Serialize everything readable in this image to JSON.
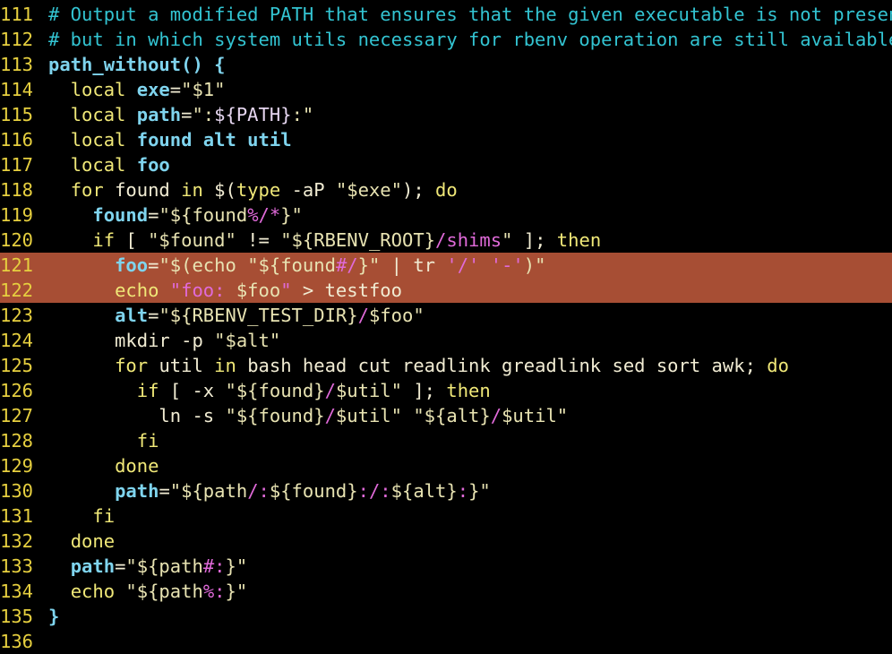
{
  "editor": {
    "colors": {
      "background": "#000000",
      "line_number": "#e6cf3f",
      "highlight": "#a74e34",
      "comment": "#33c4d2",
      "keyword": "#f0e878",
      "variable": "#7fd4ee",
      "pink": "#e06ad9"
    },
    "lines": [
      {
        "n": "111",
        "segs": [
          {
            "c": "c",
            "t": "# Output a modified PATH that ensures that the given executable is not present,"
          }
        ]
      },
      {
        "n": "112",
        "segs": [
          {
            "c": "c",
            "t": "# but in which system utils necessary for rbenv operation are still available."
          }
        ]
      },
      {
        "n": "113",
        "segs": [
          {
            "c": "v",
            "t": "path_without"
          },
          {
            "c": "v",
            "t": "() {"
          }
        ]
      },
      {
        "n": "114",
        "segs": [
          {
            "c": "w",
            "t": "  "
          },
          {
            "c": "k",
            "t": "local "
          },
          {
            "c": "v",
            "t": "exe"
          },
          {
            "c": "w",
            "t": "="
          },
          {
            "c": "s",
            "t": "\"$1\""
          }
        ]
      },
      {
        "n": "115",
        "segs": [
          {
            "c": "w",
            "t": "  "
          },
          {
            "c": "k",
            "t": "local "
          },
          {
            "c": "v",
            "t": "path"
          },
          {
            "c": "w",
            "t": "="
          },
          {
            "c": "s",
            "t": "\":"
          },
          {
            "c": "e",
            "t": "${PATH}"
          },
          {
            "c": "s",
            "t": ":\""
          }
        ]
      },
      {
        "n": "116",
        "segs": [
          {
            "c": "w",
            "t": "  "
          },
          {
            "c": "k",
            "t": "local "
          },
          {
            "c": "v",
            "t": "found alt util"
          }
        ]
      },
      {
        "n": "117",
        "segs": [
          {
            "c": "w",
            "t": "  "
          },
          {
            "c": "k",
            "t": "local "
          },
          {
            "c": "v",
            "t": "foo"
          }
        ]
      },
      {
        "n": "118",
        "segs": [
          {
            "c": "w",
            "t": "  "
          },
          {
            "c": "k",
            "t": "for "
          },
          {
            "c": "w",
            "t": "found "
          },
          {
            "c": "k",
            "t": "in "
          },
          {
            "c": "w",
            "t": "$("
          },
          {
            "c": "k",
            "t": "type "
          },
          {
            "c": "w",
            "t": "-aP "
          },
          {
            "c": "s",
            "t": "\"$exe\""
          },
          {
            "c": "w",
            "t": "); "
          },
          {
            "c": "k",
            "t": "do"
          }
        ]
      },
      {
        "n": "119",
        "segs": [
          {
            "c": "w",
            "t": "    "
          },
          {
            "c": "v",
            "t": "found"
          },
          {
            "c": "w",
            "t": "="
          },
          {
            "c": "s",
            "t": "\"${found"
          },
          {
            "c": "p",
            "t": "%/*"
          },
          {
            "c": "s",
            "t": "}\""
          }
        ]
      },
      {
        "n": "120",
        "segs": [
          {
            "c": "w",
            "t": "    "
          },
          {
            "c": "k",
            "t": "if "
          },
          {
            "c": "w",
            "t": "[ "
          },
          {
            "c": "s",
            "t": "\"$found\""
          },
          {
            "c": "w",
            "t": " != "
          },
          {
            "c": "s",
            "t": "\"${RBENV_ROOT}"
          },
          {
            "c": "p",
            "t": "/shims"
          },
          {
            "c": "s",
            "t": "\""
          },
          {
            "c": "w",
            "t": " ]; "
          },
          {
            "c": "k",
            "t": "then"
          }
        ]
      },
      {
        "n": "121",
        "hl": true,
        "segs": [
          {
            "c": "w",
            "t": "      "
          },
          {
            "c": "v",
            "t": "foo"
          },
          {
            "c": "w",
            "t": "="
          },
          {
            "c": "s",
            "t": "\"$(echo "
          },
          {
            "c": "s",
            "t": "\"${found"
          },
          {
            "c": "p",
            "t": "#/"
          },
          {
            "c": "s",
            "t": "}\""
          },
          {
            "c": "w",
            "t": " | tr "
          },
          {
            "c": "p",
            "t": "'/'"
          },
          {
            "c": "w",
            "t": " "
          },
          {
            "c": "p",
            "t": "'-'"
          },
          {
            "c": "s",
            "t": ")\""
          }
        ]
      },
      {
        "n": "122",
        "hl": true,
        "segs": [
          {
            "c": "w",
            "t": "      "
          },
          {
            "c": "k",
            "t": "echo "
          },
          {
            "c": "p",
            "t": "\"foo: "
          },
          {
            "c": "s",
            "t": "$foo"
          },
          {
            "c": "p",
            "t": "\""
          },
          {
            "c": "w",
            "t": " > testfoo"
          }
        ]
      },
      {
        "n": "123",
        "segs": [
          {
            "c": "w",
            "t": "      "
          },
          {
            "c": "v",
            "t": "alt"
          },
          {
            "c": "w",
            "t": "="
          },
          {
            "c": "s",
            "t": "\"${RBENV_TEST_DIR}"
          },
          {
            "c": "p",
            "t": "/"
          },
          {
            "c": "s",
            "t": "$foo\""
          }
        ]
      },
      {
        "n": "124",
        "segs": [
          {
            "c": "w",
            "t": "      mkdir -p "
          },
          {
            "c": "s",
            "t": "\"$alt\""
          }
        ]
      },
      {
        "n": "125",
        "segs": [
          {
            "c": "w",
            "t": "      "
          },
          {
            "c": "k",
            "t": "for "
          },
          {
            "c": "w",
            "t": "util "
          },
          {
            "c": "k",
            "t": "in "
          },
          {
            "c": "w",
            "t": "bash head cut readlink greadlink sed sort awk; "
          },
          {
            "c": "k",
            "t": "do"
          }
        ]
      },
      {
        "n": "126",
        "segs": [
          {
            "c": "w",
            "t": "        "
          },
          {
            "c": "k",
            "t": "if "
          },
          {
            "c": "w",
            "t": "[ -x "
          },
          {
            "c": "s",
            "t": "\"${found}"
          },
          {
            "c": "p",
            "t": "/"
          },
          {
            "c": "s",
            "t": "$util\""
          },
          {
            "c": "w",
            "t": " ]; "
          },
          {
            "c": "k",
            "t": "then"
          }
        ]
      },
      {
        "n": "127",
        "segs": [
          {
            "c": "w",
            "t": "          ln -s "
          },
          {
            "c": "s",
            "t": "\"${found}"
          },
          {
            "c": "p",
            "t": "/"
          },
          {
            "c": "s",
            "t": "$util\""
          },
          {
            "c": "w",
            "t": " "
          },
          {
            "c": "s",
            "t": "\"${alt}"
          },
          {
            "c": "p",
            "t": "/"
          },
          {
            "c": "s",
            "t": "$util\""
          }
        ]
      },
      {
        "n": "128",
        "segs": [
          {
            "c": "w",
            "t": "        "
          },
          {
            "c": "k",
            "t": "fi"
          }
        ]
      },
      {
        "n": "129",
        "segs": [
          {
            "c": "w",
            "t": "      "
          },
          {
            "c": "k",
            "t": "done"
          }
        ]
      },
      {
        "n": "130",
        "segs": [
          {
            "c": "w",
            "t": "      "
          },
          {
            "c": "v",
            "t": "path"
          },
          {
            "c": "w",
            "t": "="
          },
          {
            "c": "s",
            "t": "\"${path"
          },
          {
            "c": "p",
            "t": "/:"
          },
          {
            "c": "s",
            "t": "${found}"
          },
          {
            "c": "p",
            "t": ":/:"
          },
          {
            "c": "s",
            "t": "${alt}"
          },
          {
            "c": "p",
            "t": ":"
          },
          {
            "c": "s",
            "t": "}\""
          }
        ]
      },
      {
        "n": "131",
        "segs": [
          {
            "c": "w",
            "t": "    "
          },
          {
            "c": "k",
            "t": "fi"
          }
        ]
      },
      {
        "n": "132",
        "segs": [
          {
            "c": "w",
            "t": "  "
          },
          {
            "c": "k",
            "t": "done"
          }
        ]
      },
      {
        "n": "133",
        "segs": [
          {
            "c": "w",
            "t": "  "
          },
          {
            "c": "v",
            "t": "path"
          },
          {
            "c": "w",
            "t": "="
          },
          {
            "c": "s",
            "t": "\"${path"
          },
          {
            "c": "p",
            "t": "#:"
          },
          {
            "c": "s",
            "t": "}\""
          }
        ]
      },
      {
        "n": "134",
        "segs": [
          {
            "c": "w",
            "t": "  "
          },
          {
            "c": "k",
            "t": "echo "
          },
          {
            "c": "s",
            "t": "\"${path"
          },
          {
            "c": "p",
            "t": "%:"
          },
          {
            "c": "s",
            "t": "}\""
          }
        ]
      },
      {
        "n": "135",
        "segs": [
          {
            "c": "v",
            "t": "}"
          }
        ]
      },
      {
        "n": "136",
        "segs": []
      }
    ]
  }
}
